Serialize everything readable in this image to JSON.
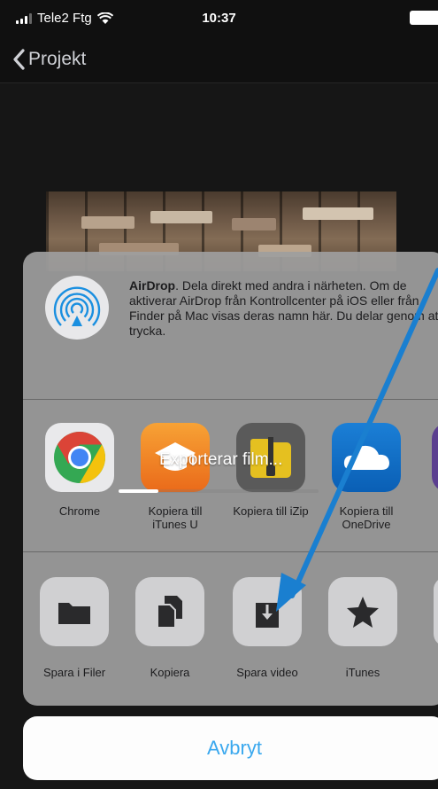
{
  "status_bar": {
    "carrier": "Tele2 Ftg",
    "time": "10:37"
  },
  "nav": {
    "back_label": "Projekt"
  },
  "airdrop": {
    "title": "AirDrop",
    "description": ". Dela direkt med andra i närheten. Om de aktiverar AirDrop från Kontrollcenter på iOS eller från Finder på Mac visas deras namn här. Du delar genom att trycka."
  },
  "apps": [
    {
      "label": "Chrome",
      "icon": "chrome-icon"
    },
    {
      "label": "Kopiera till iTunes U",
      "icon": "itunes-u-icon"
    },
    {
      "label": "Kopiera till iZip",
      "icon": "izip-icon"
    },
    {
      "label": "Kopiera till OneDrive",
      "icon": "onedrive-icon"
    }
  ],
  "actions": [
    {
      "label": "Spara i Filer",
      "icon": "folder-icon"
    },
    {
      "label": "Kopiera",
      "icon": "copy-icon"
    },
    {
      "label": "Spara video",
      "icon": "save-video-icon"
    },
    {
      "label": "iTunes",
      "icon": "star-icon"
    }
  ],
  "progress": {
    "label": "Exporterar film...",
    "fraction": 0.2
  },
  "cancel_label": "Avbryt",
  "colors": {
    "accent": "#3aa8ee",
    "annotation_arrow": "#1a7fd0"
  }
}
